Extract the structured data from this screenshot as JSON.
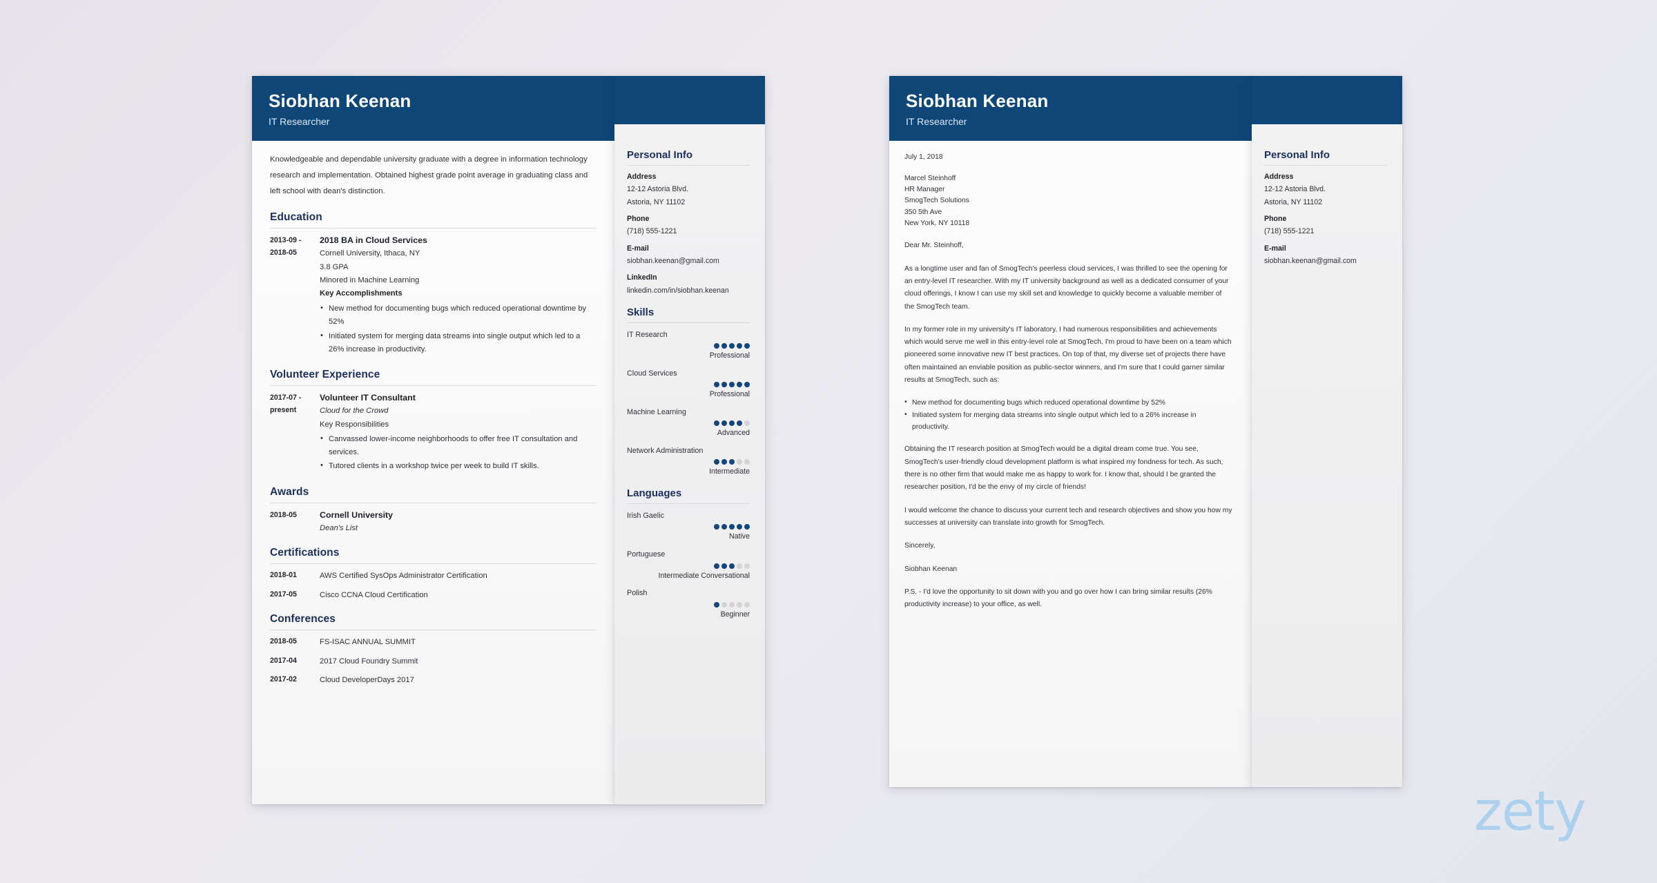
{
  "header": {
    "name": "Siobhan Keenan",
    "job_title": "IT Researcher",
    "banner_color": "#0e4677"
  },
  "resume": {
    "summary": "Knowledgeable and dependable university graduate with a degree in information technology research and implementation. Obtained highest grade point average in graduating class and left school with dean's distinction.",
    "education": {
      "heading": "Education",
      "date": "2013-09 - 2018-05",
      "date_line1": "2013-09 -",
      "date_line2": "2018-05",
      "degree": "2018 BA in Cloud Services",
      "school": "Cornell University, Ithaca, NY",
      "gpa": "3.8 GPA",
      "minor": "Minored in Machine Learning",
      "accomplishments_label": "Key Accomplishments",
      "accomplishments": [
        "New method for documenting bugs which reduced operational downtime by 52%",
        "Initiated system for merging data streams into single output which led to a 26% increase in productivity."
      ]
    },
    "volunteer": {
      "heading": "Volunteer Experience",
      "date_line1": "2017-07 -",
      "date_line2": "present",
      "title": "Volunteer IT Consultant",
      "org": "Cloud for the Crowd",
      "responsibilities_label": "Key Responsibilities",
      "responsibilities": [
        "Canvassed lower-income neighborhoods to offer free IT consultation and services.",
        "Tutored clients in a workshop twice per week to build IT skills."
      ]
    },
    "awards": {
      "heading": "Awards",
      "date": "2018-05",
      "title": "Cornell University",
      "detail": "Dean's List"
    },
    "certifications": {
      "heading": "Certifications",
      "items": [
        {
          "date": "2018-01",
          "text": "AWS Certified SysOps Administrator Certification"
        },
        {
          "date": "2017-05",
          "text": "Cisco CCNA Cloud Certification"
        }
      ]
    },
    "conferences": {
      "heading": "Conferences",
      "items": [
        {
          "date": "2018-05",
          "text": "FS-ISAC ANNUAL SUMMIT"
        },
        {
          "date": "2017-04",
          "text": "2017 Cloud Foundry Summit"
        },
        {
          "date": "2017-02",
          "text": "Cloud DeveloperDays 2017"
        }
      ]
    }
  },
  "resume_aside": {
    "personal_info": {
      "heading": "Personal Info",
      "address_label": "Address",
      "address_line1": "12-12 Astoria Blvd.",
      "address_line2": "Astoria, NY 11102",
      "phone_label": "Phone",
      "phone": "(718) 555-1221",
      "email_label": "E-mail",
      "email": "siobhan.keenan@gmail.com",
      "linkedin_label": "LinkedIn",
      "linkedin": "linkedin.com/in/siobhan.keenan"
    },
    "skills": {
      "heading": "Skills",
      "items": [
        {
          "name": "IT Research",
          "filled": 5,
          "total": 5,
          "level": "Professional"
        },
        {
          "name": "Cloud Services",
          "filled": 5,
          "total": 5,
          "level": "Professional"
        },
        {
          "name": "Machine Learning",
          "filled": 4,
          "total": 5,
          "level": "Advanced"
        },
        {
          "name": "Network Administration",
          "filled": 3,
          "total": 5,
          "level": "Intermediate"
        }
      ]
    },
    "languages": {
      "heading": "Languages",
      "items": [
        {
          "name": "Irish Gaelic",
          "filled": 5,
          "total": 5,
          "level": "Native"
        },
        {
          "name": "Portuguese",
          "filled": 3,
          "total": 5,
          "level": "Intermediate Conversational"
        },
        {
          "name": "Polish",
          "filled": 1,
          "total": 5,
          "level": "Beginner"
        }
      ]
    },
    "dot_on_color": "#16457c",
    "dot_off_color": "#d4d4d6"
  },
  "cover_letter": {
    "date": "July 1, 2018",
    "recipient": {
      "name": "Marcel Steinhoff",
      "title": "HR Manager",
      "company": "SmogTech Solutions",
      "street": "350 5th Ave",
      "city": "New York, NY 10118"
    },
    "salutation": "Dear Mr. Steinhoff,",
    "paragraph1": "As a longtime user and fan of SmogTech's peerless cloud services, I was thrilled to see the opening for an entry-level IT researcher. With my IT university background as well as a dedicated consumer of your cloud offerings, I know I can use my skill set and knowledge to quickly become a valuable member of the SmogTech team.",
    "paragraph2": "In my former role in my university's IT laboratory, I had numerous responsibilities and achievements which would serve me well in this entry-level role at SmogTech. I'm proud to have been on a team which pioneered some innovative new IT best practices. On top of that, my diverse set of projects there have often maintained an enviable position as public-sector winners, and I'm sure that I could garner similar results at SmogTech, such as:",
    "bullets": [
      "New method for documenting bugs which reduced operational downtime by 52%",
      "Initiated system for merging data streams into single output which led to a 26% increase in productivity."
    ],
    "paragraph3": "Obtaining the IT research position at SmogTech would be a digital dream come true. You see, SmogTech's user-friendly cloud development platform is what inspired my fondness for tech. As such, there is no other firm that would make me as happy to work for. I know that, should I be granted the researcher position, I'd be the envy of my circle of friends!",
    "paragraph4": "I would welcome the chance to discuss your current tech and research objectives and show you how my successes at university can translate into growth for SmogTech.",
    "closing": "Sincerely,",
    "signature": "Siobhan Keenan",
    "postscript": "P.S. - I'd love the opportunity to sit down with you and go over how I can bring similar results (26% productivity increase) to your office, as well."
  },
  "letter_aside": {
    "personal_info": {
      "heading": "Personal Info",
      "address_label": "Address",
      "address_line1": "12-12 Astoria Blvd.",
      "address_line2": "Astoria, NY 11102",
      "phone_label": "Phone",
      "phone": "(718) 555-1221",
      "email_label": "E-mail",
      "email": "siobhan.keenan@gmail.com"
    }
  },
  "watermark": {
    "text": "zety",
    "color": "#a8d0ee"
  }
}
